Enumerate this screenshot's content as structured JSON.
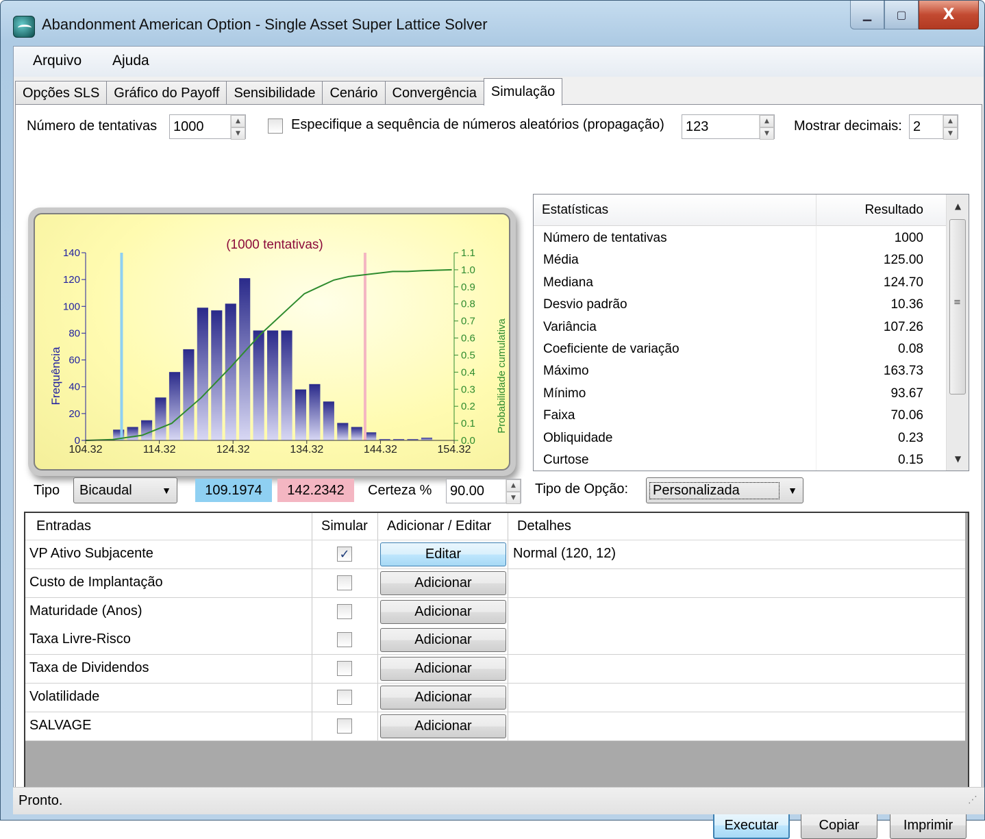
{
  "window": {
    "title": "Abandonment American Option - Single Asset Super Lattice Solver"
  },
  "menu": [
    "Arquivo",
    "Ajuda"
  ],
  "tabs": [
    "Opções SLS",
    "Gráfico do Payoff",
    "Sensibilidade",
    "Cenário",
    "Convergência",
    "Simulação"
  ],
  "controls": {
    "trials_label": "Número de tentativas",
    "trials_value": "1000",
    "seed_label": "Especifique a sequência de números aleatórios (propagação)",
    "seed_value": "123",
    "decimals_label": "Mostrar decimais:",
    "decimals_value": "2"
  },
  "chart_data": {
    "type": "bar",
    "title": "(1000 tentativas)",
    "ylabel": "Frequência",
    "y2label": "Probabilidade cumulativa",
    "ylim": [
      0,
      140
    ],
    "y2lim": [
      0.0,
      1.1
    ],
    "xlim": [
      104.32,
      154.32
    ],
    "x_ticks": [
      "104.32",
      "114.32",
      "124.32",
      "134.32",
      "144.32",
      "154.32"
    ],
    "y_ticks": [
      "0",
      "20",
      "40",
      "60",
      "80",
      "100",
      "120",
      "140"
    ],
    "y2_ticks": [
      "0.0",
      "0.1",
      "0.2",
      "0.3",
      "0.4",
      "0.5",
      "0.6",
      "0.7",
      "0.8",
      "0.9",
      "1.0",
      "1.1"
    ],
    "x": [
      108.8,
      110.7,
      112.6,
      114.5,
      116.4,
      118.3,
      120.2,
      122.1,
      124.0,
      125.9,
      127.8,
      129.7,
      131.6,
      133.5,
      135.4,
      137.3,
      139.2,
      141.1,
      143.0,
      144.9,
      146.8,
      148.7,
      150.6
    ],
    "values": [
      8,
      10,
      15,
      32,
      51,
      68,
      99,
      97,
      102,
      121,
      82,
      82,
      82,
      38,
      42,
      29,
      13,
      10,
      6,
      1,
      1,
      1,
      2
    ],
    "cumulative_series": {
      "name": "Probabilidade cumulativa",
      "x": [
        104.32,
        108,
        112,
        116,
        120,
        124,
        128,
        132,
        134,
        136,
        138,
        140,
        142,
        144,
        146,
        148,
        150,
        154
      ],
      "values": [
        0.0,
        0.005,
        0.03,
        0.1,
        0.25,
        0.43,
        0.62,
        0.78,
        0.86,
        0.9,
        0.94,
        0.96,
        0.97,
        0.98,
        0.99,
        0.99,
        0.995,
        1.0
      ]
    },
    "lower_line": 109.1974,
    "upper_line": 142.2342
  },
  "statistics": {
    "col_stat": "Estatísticas",
    "col_result": "Resultado",
    "rows": [
      {
        "k": "Número de tentativas",
        "v": "1000"
      },
      {
        "k": "Média",
        "v": "125.00"
      },
      {
        "k": "Mediana",
        "v": "124.70"
      },
      {
        "k": "Desvio padrão",
        "v": "10.36"
      },
      {
        "k": "Variância",
        "v": "107.26"
      },
      {
        "k": "Coeficiente de variação",
        "v": "0.08"
      },
      {
        "k": "Máximo",
        "v": "163.73"
      },
      {
        "k": "Mínimo",
        "v": "93.67"
      },
      {
        "k": "Faixa",
        "v": "70.06"
      },
      {
        "k": "Obliquidade",
        "v": "0.23"
      },
      {
        "k": "Curtose",
        "v": "0.15"
      }
    ]
  },
  "bottom_controls": {
    "type_label": "Tipo",
    "type_value": "Bicaudal",
    "lower_value": "109.1974",
    "upper_value": "142.2342",
    "certainty_label": "Certeza %",
    "certainty_value": "90.00",
    "option_type_label": "Tipo de Opção:",
    "option_type_value": "Personalizada"
  },
  "inputs_grid": {
    "headers": [
      "Entradas",
      "Simular",
      "Adicionar / Editar",
      "Detalhes"
    ],
    "rows": [
      {
        "name": "VP Ativo Subjacente",
        "simulate": true,
        "action": "Editar",
        "details": "Normal (120, 12)"
      },
      {
        "name": "Custo de Implantação",
        "simulate": false,
        "action": "Adicionar",
        "details": ""
      },
      {
        "name": "Maturidade (Anos)",
        "simulate": false,
        "action": "Adicionar",
        "details": ""
      },
      {
        "name": "Taxa Livre-Risco",
        "simulate": false,
        "action": "Adicionar",
        "details": ""
      },
      {
        "name": "Taxa de Dividendos",
        "simulate": false,
        "action": "Adicionar",
        "details": ""
      },
      {
        "name": "Volatilidade",
        "simulate": false,
        "action": "Adicionar",
        "details": ""
      },
      {
        "name": "SALVAGE",
        "simulate": false,
        "action": "Adicionar",
        "details": ""
      }
    ]
  },
  "buttons": {
    "run": "Executar",
    "copy": "Copiar",
    "print": "Imprimir"
  },
  "status": "Pronto.",
  "colors": {
    "bar_top": "#2a2a8a",
    "bar_bottom": "#d8d8f4",
    "lower_line": "#8fd0f2",
    "upper_line": "#f4b6c2",
    "cumulative": "#2e8b2e",
    "title_color": "#8b0a3a"
  }
}
